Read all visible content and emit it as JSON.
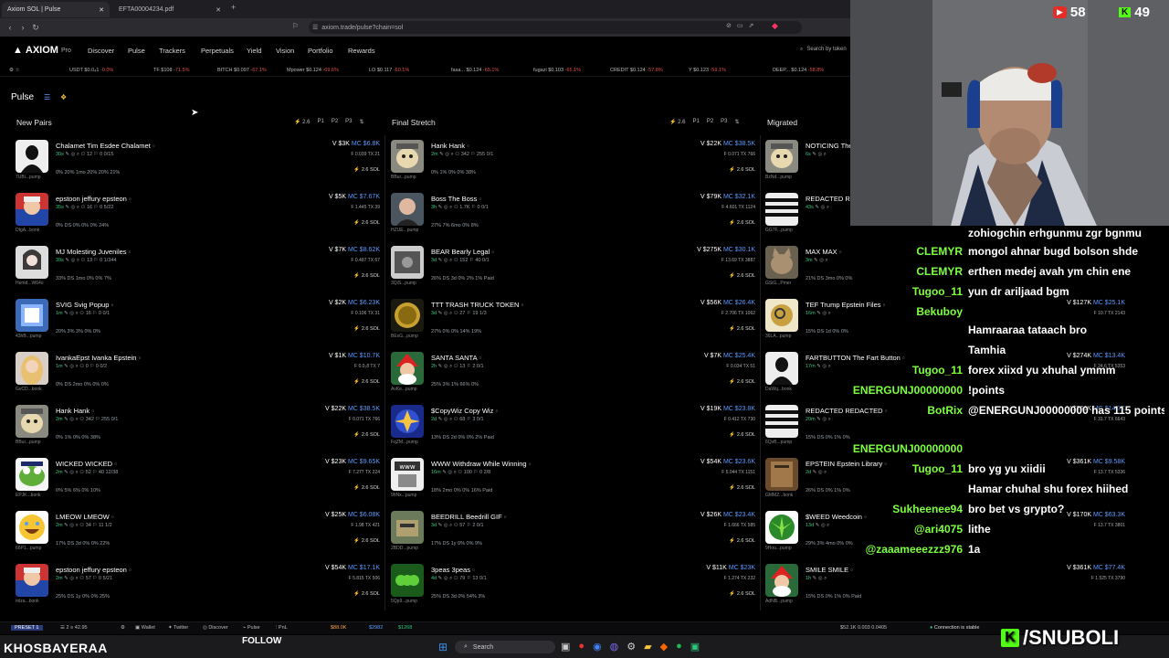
{
  "browser": {
    "tabs": [
      {
        "label": "Axiom SOL | Pulse"
      },
      {
        "label": "EFTA00004234.pdf"
      }
    ],
    "url": "axiom.trade/pulse?chain=sol"
  },
  "app": {
    "logo": "AXIOM",
    "logo_sub": "Pro",
    "nav": [
      "Discover",
      "Pulse",
      "Trackers",
      "Perpetuals",
      "Yield",
      "Vision",
      "Portfolio",
      "Rewards"
    ],
    "search_placeholder": "Search by token",
    "page_title": "Pulse"
  },
  "ticker": [
    {
      "name": "USDT",
      "price": "$0.0₄1",
      "change": "-0.0%"
    },
    {
      "name": "TF",
      "price": "$108",
      "change": "-71.5%"
    },
    {
      "name": "BITCH",
      "price": "$0.097",
      "change": "-67.1%"
    },
    {
      "name": "Mpower",
      "price": "$0.124",
      "change": "-69.6%"
    },
    {
      "name": "LO",
      "price": "$0.117",
      "change": "-60.1%"
    },
    {
      "name": "fasa...",
      "price": "$0.124",
      "change": "-65.1%"
    },
    {
      "name": "fugazi",
      "price": "$0.103",
      "change": "-65.1%"
    },
    {
      "name": "CREDIT",
      "price": "$0.124",
      "change": "-57.8%"
    },
    {
      "name": "Y",
      "price": "$0.123",
      "change": "-59.1%"
    },
    {
      "name": "DEEP...",
      "price": "$0.124",
      "change": "-58.8%"
    }
  ],
  "columns": [
    {
      "title": "New Pairs",
      "count": "2.6",
      "presets": [
        "P1",
        "P2",
        "P3"
      ],
      "tokens": [
        {
          "name": "Chalamet Tim Esdee Chalamet",
          "age": "30s",
          "holders": "12",
          "tx": "0",
          "extra": "0/15",
          "tag": "7UBi...pump",
          "vol": "V $3K",
          "mc": "MC $6.8K",
          "f": "F 0.039  TX 21",
          "buy": "2.6 SOL",
          "stats": "0%  20% 1mo  20%  20%  21%",
          "img": "black"
        },
        {
          "name": "epstoon jeffury epsteon",
          "age": "35s",
          "holders": "16",
          "tx": "0",
          "extra": "5/22",
          "tag": "DtgA...bonk",
          "vol": "V $5K",
          "mc": "MC $7.67K",
          "f": "F 1.445  TX 39",
          "buy": "2.6 SOL",
          "stats": "0%  DS 0%  0%  0%  24%",
          "img": "face"
        },
        {
          "name": "MJ Molesting Juveniles",
          "age": "39s",
          "holders": "13",
          "tx": "0",
          "extra": "1/344",
          "tag": "Hemd...W64o",
          "vol": "V $7K",
          "mc": "MC $8.62K",
          "f": "F 0.497  TX 67",
          "buy": "2.6 SOL",
          "stats": "33%  DS 1mo  0%  0%  7%",
          "img": "mj"
        },
        {
          "name": "SVIG Svig Popup",
          "age": "1m",
          "holders": "16",
          "tx": "0",
          "extra": "0/1",
          "tag": "43hB...pump",
          "vol": "V $2K",
          "mc": "MC $6.23K",
          "f": "F 0.106  TX 31",
          "buy": "2.6 SOL",
          "stats": "20%  3%  3%  0%  0%",
          "img": "blue"
        },
        {
          "name": "IvankaEpst Ivanka Epstein",
          "age": "1m",
          "holders": "0",
          "tx": "0",
          "extra": "0/2",
          "tag": "GvCD...bonk",
          "vol": "V $1K",
          "mc": "MC $10.7K",
          "f": "F 0.0₂8  TX 7",
          "buy": "2.6 SOL",
          "stats": "0%  DS 2mo  0%  0%  0%",
          "img": "blonde"
        },
        {
          "name": "Hank Hank",
          "age": "2m",
          "holders": "342",
          "tx": "255",
          "extra": "0/1",
          "tag": "BBur...pump",
          "vol": "V $22K",
          "mc": "MC $38.5K",
          "f": "F 0.071  TX 766",
          "buy": "2.6 SOL",
          "stats": "0%  1%  0%  0%  38%",
          "img": "dog"
        },
        {
          "name": "WICKED WICKED",
          "age": "2m",
          "holders": "52",
          "tx": "40",
          "extra": "12/38",
          "tag": "EPJK...bonk",
          "vol": "V $23K",
          "mc": "MC $9.65K",
          "f": "F 7.277  TX 224",
          "buy": "2.6 SOL",
          "stats": "0%  5%  6%  0%  10%",
          "img": "frog"
        },
        {
          "name": "LMEOW LMEOW",
          "age": "2m",
          "holders": "34",
          "tx": "11",
          "extra": "1/2",
          "tag": "66P1...pump",
          "vol": "V $25K",
          "mc": "MC $6.08K",
          "f": "F 1.98  TX 421",
          "buy": "2.6 SOL",
          "stats": "17%  DS 3d  0%  0%  22%",
          "img": "emoji"
        },
        {
          "name": "epstoon jeffury epsteon",
          "age": "2m",
          "holders": "57",
          "tx": "0",
          "extra": "5/21",
          "tag": "mlza...bonk",
          "vol": "V $54K",
          "mc": "MC $17.1K",
          "f": "F 5.815  TX 506",
          "buy": "2.6 SOL",
          "stats": "25%  DS 1y  0%  0%  25%",
          "img": "face"
        }
      ]
    },
    {
      "title": "Final Stretch",
      "count": "2.6",
      "presets": [
        "P1",
        "P2",
        "P3"
      ],
      "tokens": [
        {
          "name": "Hank Hank",
          "age": "2m",
          "holders": "342",
          "tx": "255",
          "extra": "0/1",
          "tag": "BBur...pump",
          "vol": "V $22K",
          "mc": "MC $38.5K",
          "f": "F 0.071  TX 766",
          "buy": "2.6 SOL",
          "stats": "0%  1%  0%  0%  38%",
          "img": "dog"
        },
        {
          "name": "Boss The Boss",
          "age": "3h",
          "holders": "1.7K",
          "tx": "0",
          "extra": "0/1",
          "tag": "HZUE...pump",
          "vol": "V $79K",
          "mc": "MC $32.1K",
          "f": "F 4.601  TX 1124",
          "buy": "2.6 SOL",
          "stats": "27%  7%  6mo  0%  8%",
          "img": "man"
        },
        {
          "name": "BEAR Bearly Legal",
          "age": "3d",
          "holders": "152",
          "tx": "40",
          "extra": "0/1",
          "tag": "3QiS...pump",
          "vol": "V $275K",
          "mc": "MC $30.1K",
          "f": "F 13.69  TX 3887",
          "buy": "2.6 SOL",
          "stats": "26%  DS 3d  0%  2%  1%  Paid",
          "img": "grey"
        },
        {
          "name": "TTT TRASH TRUCK TOKEN",
          "age": "3d",
          "holders": "27",
          "tx": "19",
          "extra": "1/3",
          "tag": "BEsG...pump",
          "vol": "V $56K",
          "mc": "MC $26.4K",
          "f": "F 2.706  TX 1062",
          "buy": "2.6 SOL",
          "stats": "27%  0%  0%  14%  19%",
          "img": "coin"
        },
        {
          "name": "SANTA SANTA",
          "age": "2h",
          "holders": "13",
          "tx": "2",
          "extra": "0/1",
          "tag": "AvKe...pump",
          "vol": "V $7K",
          "mc": "MC $25.4K",
          "f": "F 0.034  TX 51",
          "buy": "2.6 SOL",
          "stats": "25%  3%  1%  66%  0%",
          "img": "santa"
        },
        {
          "name": "$CopyWiz Copy Wiz",
          "age": "2d",
          "holders": "68",
          "tx": "3",
          "extra": "0/1",
          "tag": "FqZM...pump",
          "vol": "V $19K",
          "mc": "MC $23.8K",
          "f": "F 0.412  TX 730",
          "buy": "2.6 SOL",
          "stats": "13%  DS 2d  0%  0%  2%  Paid",
          "img": "wiz"
        },
        {
          "name": "WWW Withdraw While Winning",
          "age": "16m",
          "holders": "100",
          "tx": "0",
          "extra": "2/8",
          "tag": "9hNx...pump",
          "vol": "V $54K",
          "mc": "MC $23.6K",
          "f": "F 5.044  TX 1151",
          "buy": "2.6 SOL",
          "stats": "18%  2mo  0%  0%  16%  Paid",
          "img": "www"
        },
        {
          "name": "BEEDRILL Beedrill GIF",
          "age": "3d",
          "holders": "57",
          "tx": "2",
          "extra": "0/1",
          "tag": "2BDD...pump",
          "vol": "V $26K",
          "mc": "MC $23.4K",
          "f": "F 1.666  TX 585",
          "buy": "2.6 SOL",
          "stats": "17%  DS 1y  0%  0%  9%",
          "img": "bee"
        },
        {
          "name": "3peas 3peas",
          "age": "4d",
          "holders": "79",
          "tx": "13",
          "extra": "0/1",
          "tag": "5Qp9...pump",
          "vol": "V $11K",
          "mc": "MC $23K",
          "f": "F 1.274  TX 232",
          "buy": "2.6 SOL",
          "stats": "25%  DS 3d  0%  54%  3%",
          "img": "peas"
        }
      ]
    },
    {
      "title": "Migrated",
      "tokens": [
        {
          "name": "NOTICING The",
          "age": "6s",
          "tag": "BzNd...pump",
          "img": "dog"
        },
        {
          "name": "REDACTED R",
          "age": "43s",
          "tag": "GG7F...pump",
          "img": "stripe"
        },
        {
          "name": "MAX MAX",
          "age": "3m",
          "tag": "GSiG...Pmer",
          "img": "cat",
          "stats": "21%  DS 3mo  0%  0%"
        },
        {
          "name": "TEF Trump Epstein Files",
          "age": "16m",
          "tag": "36LA...pump",
          "img": "gold",
          "stats": "15%  DS 1d  0%  0%",
          "vol": "V $127K",
          "mc": "MC $25.1K",
          "f": "F 10.7  TX 2143"
        },
        {
          "name": "FARTBUTTON The Fart Button",
          "age": "17m",
          "tag": "DaWq...bonk",
          "img": "black",
          "vol": "V $274K",
          "mc": "MC $13.4K",
          "f": "F 24.6  TX 5353"
        },
        {
          "name": "REDACTED REDACTED",
          "age": "20m",
          "tag": "6QvB...pump",
          "img": "stripe",
          "stats": "15%  DS  0%  1%  0%",
          "vol": "V $361K",
          "mc": "MC $14.2K",
          "f": "F 31.7  TX 6643"
        },
        {
          "name": "EPSTEIN Epstein Library",
          "age": "2d",
          "tag": "GMMZ...bonk",
          "img": "book",
          "stats": "26%  DS  0%  1%  0%",
          "vol": "V $361K",
          "mc": "MC $9.58K",
          "f": "F 13.7  TX 5336"
        },
        {
          "name": "$WEED Weedcoin",
          "age": "13d",
          "tag": "9Hou...pump",
          "img": "weed",
          "stats": "29%  3% 4mo  0%  0%",
          "vol": "V $170K",
          "mc": "MC $63.3K",
          "f": "F 13.7  TX 3801"
        },
        {
          "name": "SMILE SMILE",
          "age": "1h",
          "tag": "AdNB...pump",
          "img": "santa",
          "stats": "15%  DS  0%  1%  0%  Paid",
          "vol": "V $361K",
          "mc": "MC $77.4K",
          "f": "F 1.525  TX 3790"
        }
      ]
    }
  ],
  "bottom_bar": {
    "preset": "PRESET 1",
    "count": "2",
    "value": "42.95",
    "items": [
      "Wallet",
      "Twitter",
      "Discover",
      "Pulse",
      "PnL"
    ],
    "sol_price": "$88.0K",
    "btc_price": "$2982",
    "eth_price": "$1268",
    "right_stats": "$52.1K  0.003  0.0405",
    "connection": "Connection is stable"
  },
  "stream": {
    "streamer_name": "KHOSBAYERAA",
    "follow": "FOLLOW",
    "brand": "/SNUBOLI",
    "youtube_count": "58",
    "kick_count": "49",
    "chat": [
      {
        "user": "",
        "msg": "zohiogchin erhgunmu zgr bgnmu"
      },
      {
        "user": "CLEMYR",
        "msg": "mongol ahnar bugd bolson shde"
      },
      {
        "user": "CLEMYR",
        "msg": "erthen medej avah ym chin ene"
      },
      {
        "user": "Tugoo_11",
        "msg": "yun dr ariljaad bgm"
      },
      {
        "user": "Bekuboy",
        "msg": ""
      },
      {
        "user": "",
        "msg": "Hamraaraa tataach bro"
      },
      {
        "user": "",
        "msg": "Tamhia"
      },
      {
        "user": "Tugoo_11",
        "msg": "forex xiixd yu xhuhal ymmm"
      },
      {
        "user": "ENERGUNJ00000000",
        "msg": "!points"
      },
      {
        "user": "BotRix",
        "msg": "@ENERGUNJ00000000 has 115 points."
      },
      {
        "user": "ENERGUNJ00000000",
        "msg": ""
      },
      {
        "user": "Tugoo_11",
        "msg": "bro yg yu xiidii"
      },
      {
        "user": "",
        "msg": "Hamar chuhal shu forex hiihed"
      },
      {
        "user": "Sukheenee94",
        "msg": "bro bet vs grypto?"
      },
      {
        "user": "@ari4075",
        "msg": "lithe"
      },
      {
        "user": "@zaaameeezzz976",
        "msg": "1a"
      }
    ]
  },
  "taskbar": {
    "search": "Search"
  },
  "colors": {
    "green": "#2fc77c",
    "blue": "#5b9bff",
    "red": "#e25151",
    "kick": "#53fc18"
  }
}
